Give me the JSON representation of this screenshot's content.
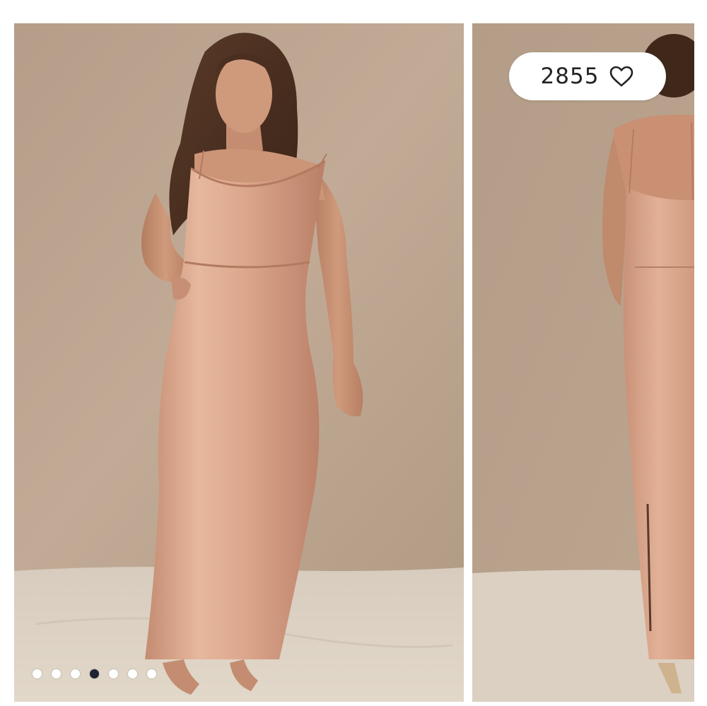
{
  "gallery": {
    "like_count": "2855",
    "icons": {
      "like": "heart-outline-icon"
    },
    "colors": {
      "backdrop": "#b9a48f",
      "floor": "#d9cdbd",
      "dress": "#d6a48a",
      "active_dot": "#1e2433"
    },
    "slides": [
      {
        "index": 1,
        "active": false
      },
      {
        "index": 2,
        "active": false
      },
      {
        "index": 3,
        "active": false
      },
      {
        "index": 4,
        "active": true
      },
      {
        "index": 5,
        "active": false
      },
      {
        "index": 6,
        "active": false
      },
      {
        "index": 7,
        "active": false
      }
    ]
  }
}
